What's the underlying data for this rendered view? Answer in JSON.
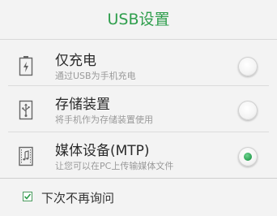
{
  "dialog": {
    "title": "USB设置"
  },
  "options": [
    {
      "icon": "charge-icon",
      "title": "仅充电",
      "subtitle": "通过USB为手机充电",
      "selected": false
    },
    {
      "icon": "usb-icon",
      "title": "存储装置",
      "subtitle": "将手机作为存储装置使用",
      "selected": false
    },
    {
      "icon": "media-file-icon",
      "title": "媒体设备(MTP)",
      "subtitle": "让您可以在PC上传输媒体文件",
      "selected": true
    }
  ],
  "footer": {
    "checkbox_label": "下次不再询问",
    "checked": true
  },
  "colors": {
    "accent": "#2e9e4c"
  }
}
